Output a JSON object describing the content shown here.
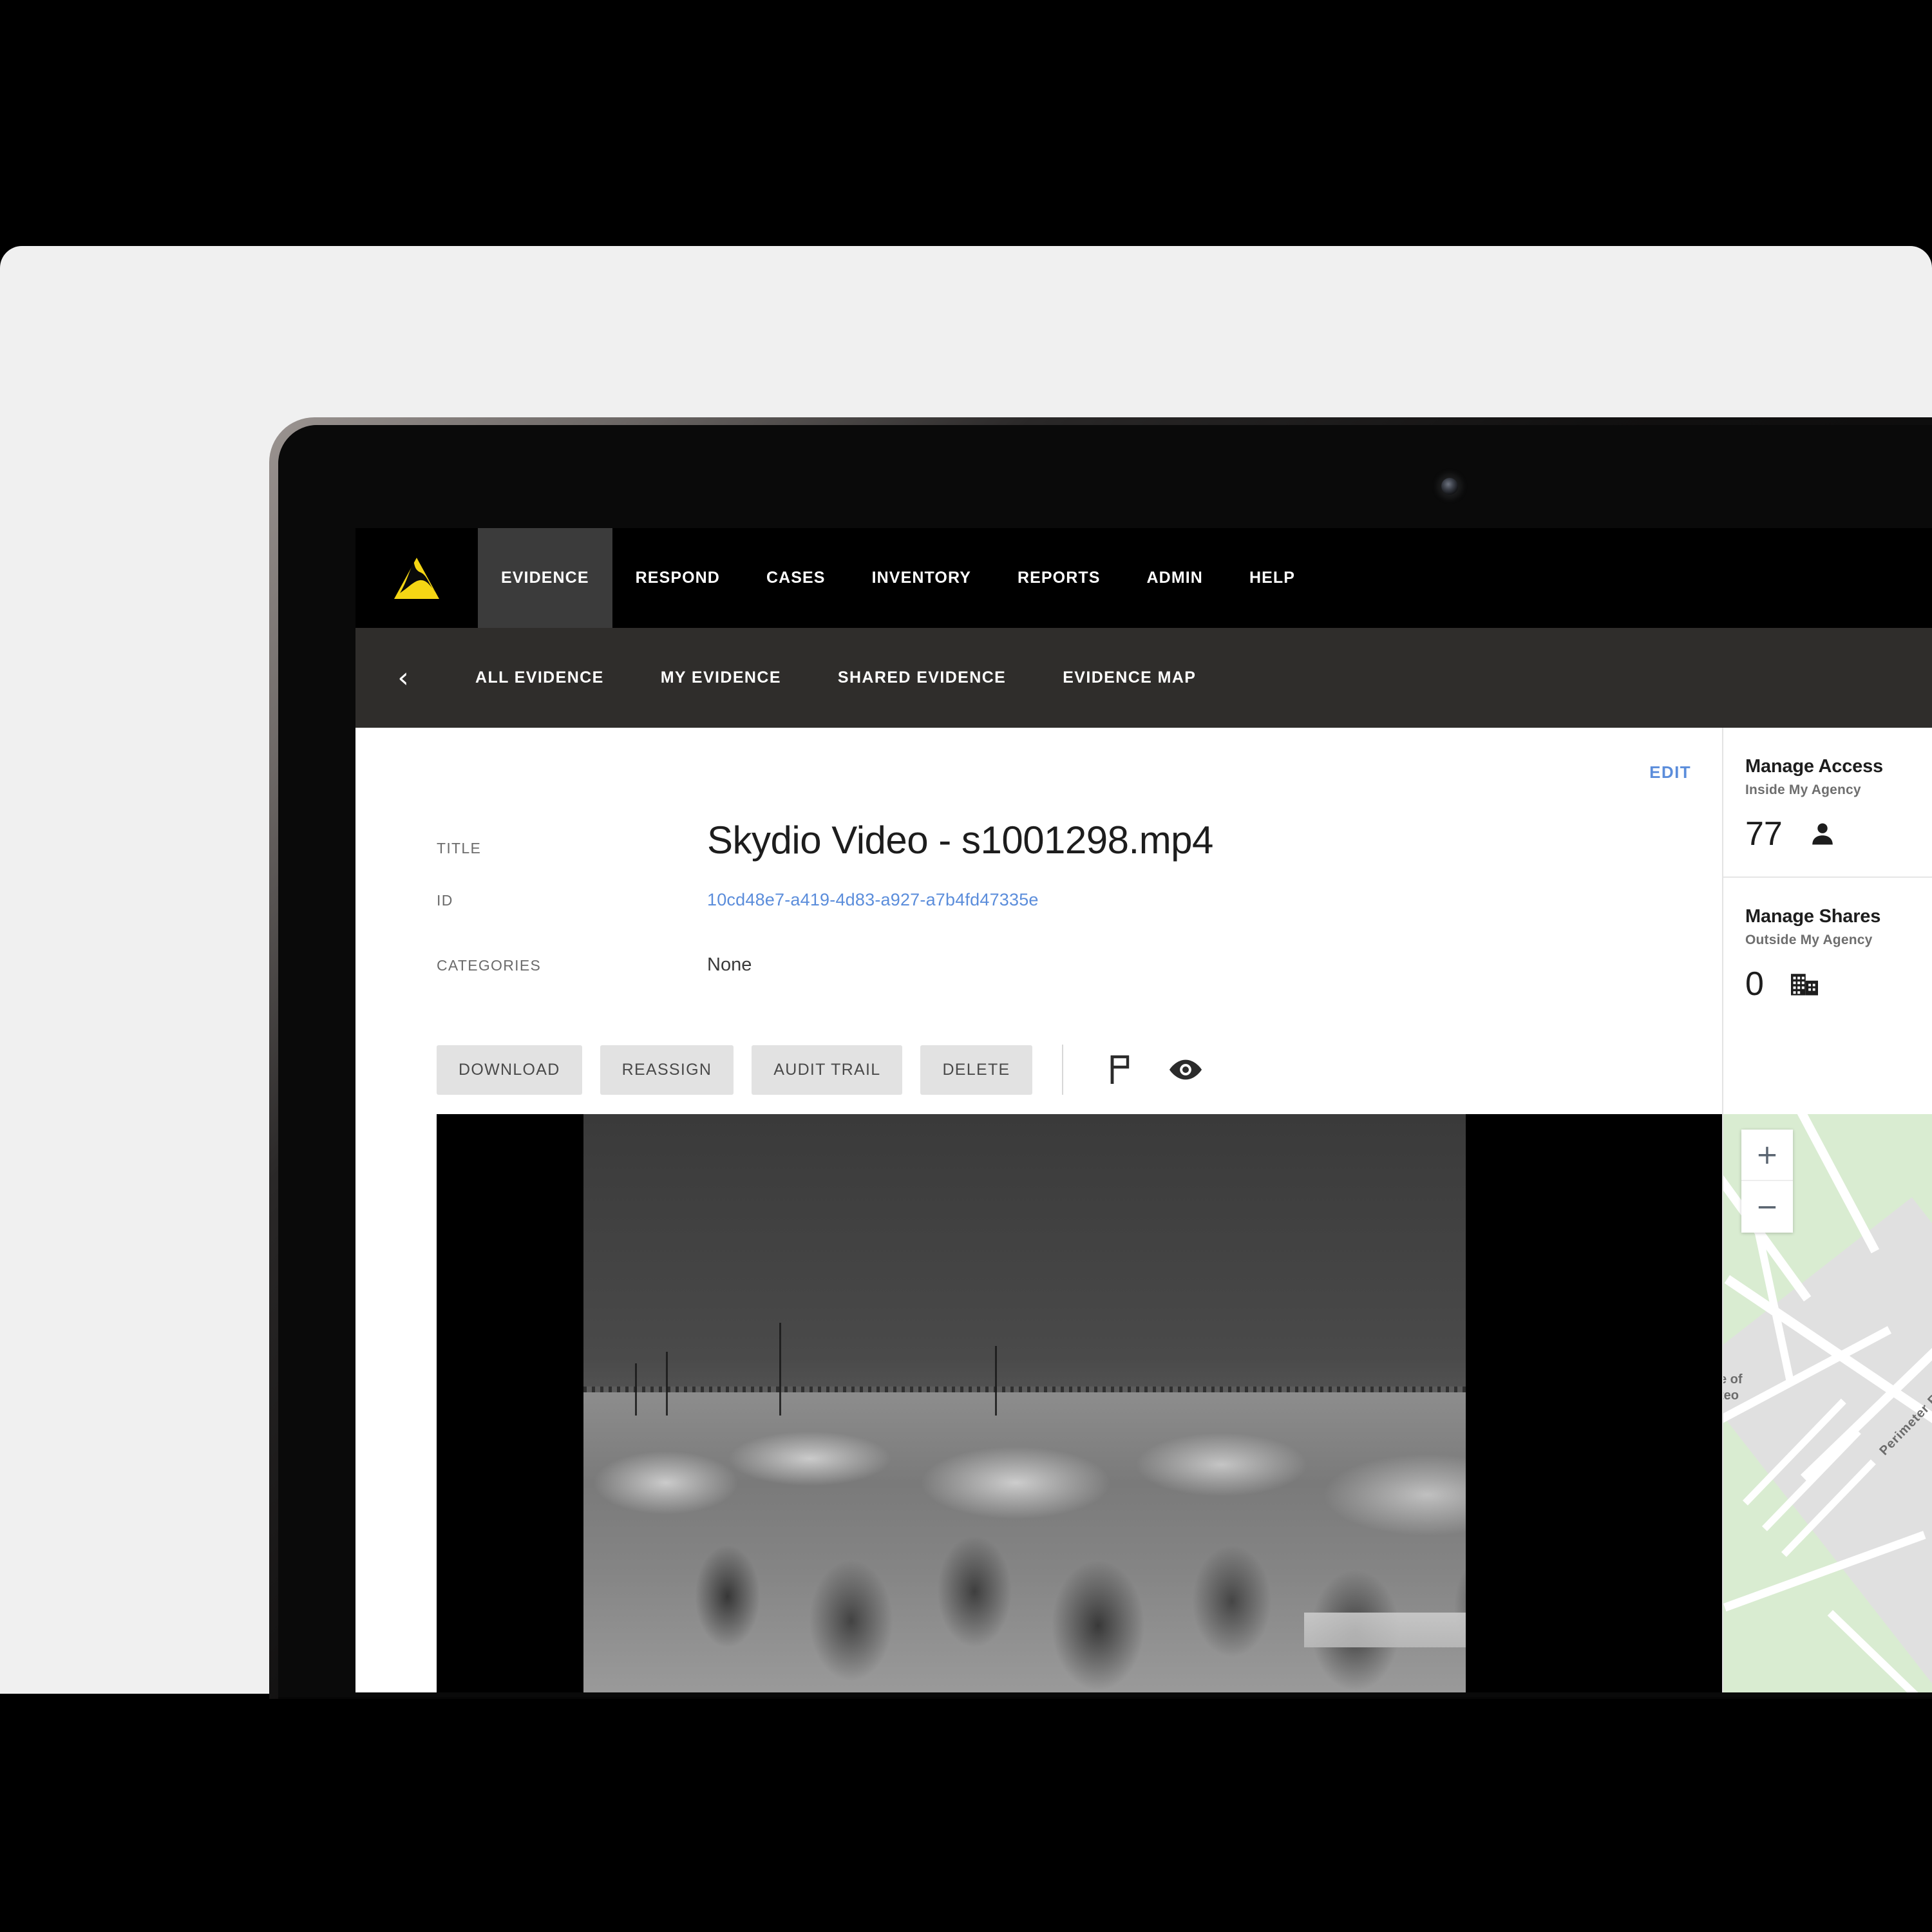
{
  "app": {
    "brand_logo": "axon-triangle-logo",
    "accent_yellow": "#f5d614",
    "link_blue": "#5b8ddb",
    "nav_bg": "#000000",
    "subnav_bg": "#2f2d2b"
  },
  "topnav": {
    "items": [
      {
        "label": "EVIDENCE",
        "active": true
      },
      {
        "label": "RESPOND",
        "active": false
      },
      {
        "label": "CASES",
        "active": false
      },
      {
        "label": "INVENTORY",
        "active": false
      },
      {
        "label": "REPORTS",
        "active": false
      },
      {
        "label": "ADMIN",
        "active": false
      },
      {
        "label": "HELP",
        "active": false
      }
    ]
  },
  "subnav": {
    "back_icon": "chevron-left-icon",
    "back_glyph": "‹",
    "items": [
      {
        "label": "ALL EVIDENCE"
      },
      {
        "label": "MY EVIDENCE"
      },
      {
        "label": "SHARED EVIDENCE"
      },
      {
        "label": "EVIDENCE MAP"
      }
    ]
  },
  "detail": {
    "edit_label": "EDIT",
    "fields": [
      {
        "label": "TITLE",
        "value": "Skydio Video - s1001298.mp4"
      },
      {
        "label": "ID",
        "value": "10cd48e7-a419-4d83-a927-a7b4fd47335e"
      },
      {
        "label": "CATEGORIES",
        "value": "None"
      }
    ]
  },
  "actions": {
    "buttons": [
      {
        "label": "DOWNLOAD"
      },
      {
        "label": "REASSIGN"
      },
      {
        "label": "AUDIT TRAIL"
      },
      {
        "label": "DELETE"
      }
    ],
    "icons": [
      {
        "name": "flag-icon"
      },
      {
        "name": "eye-icon"
      }
    ]
  },
  "media": {
    "type": "video-thumbnail",
    "description": "Grayscale aerial drone view of tree-covered hillside with buildings and roadway"
  },
  "map": {
    "zoom_in_glyph": "+",
    "zoom_out_glyph": "−",
    "labels": [
      {
        "text": "Perimeter Rd"
      },
      {
        "text": "e of\nteo"
      }
    ]
  },
  "sidebar": {
    "blocks": [
      {
        "title": "Manage Access",
        "subtitle": "Inside My Agency",
        "count": "77",
        "icon": "person-icon"
      },
      {
        "title": "Manage Shares",
        "subtitle": "Outside My Agency",
        "count": "0",
        "icon": "building-icon"
      }
    ]
  }
}
